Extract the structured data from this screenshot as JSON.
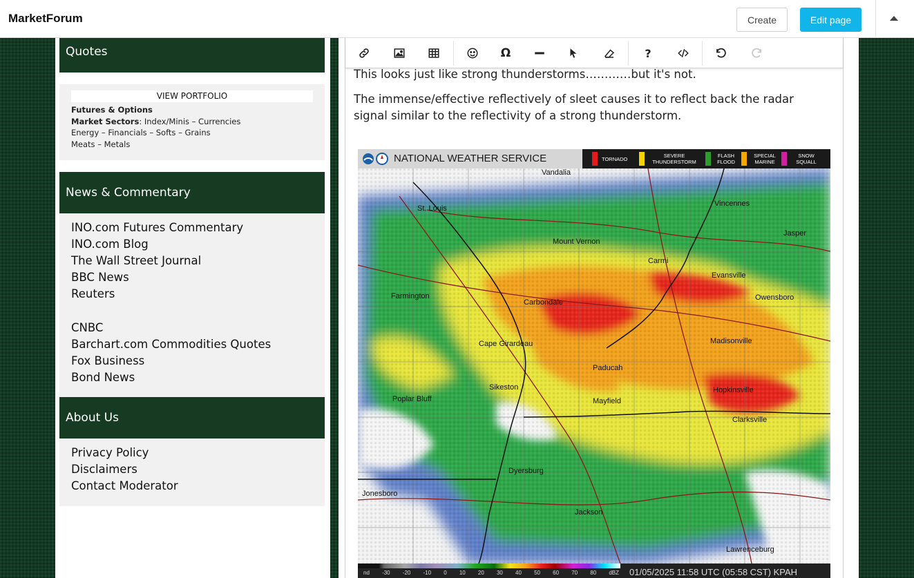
{
  "header": {
    "brand": "MarketForum",
    "create_label": "Create",
    "edit_label": "Edit page"
  },
  "sidebar": {
    "quotes": {
      "title": "Quotes",
      "portfolio_label": "VIEW PORTFOLIO",
      "futures_options": "Futures & Options",
      "market_sectors_label": "Market Sectors",
      "market_sectors_value": ": Index/Minis – Currencies",
      "line3": "Energy – Financials – Softs – Grains",
      "line4": "Meats – Metals"
    },
    "news": {
      "title": "News & Commentary",
      "links_a": [
        "INO.com Futures Commentary",
        "INO.com Blog",
        "The Wall Street Journal",
        "BBC News",
        "Reuters"
      ],
      "links_b": [
        "CNBC",
        "Barchart.com Commodities Quotes",
        "Fox Business",
        "Bond News"
      ]
    },
    "about": {
      "title": "About Us",
      "links": [
        "Privacy Policy",
        "Disclaimers",
        "Contact Moderator"
      ]
    }
  },
  "editor": {
    "toolbar": {
      "icons": [
        "link-icon",
        "image-icon",
        "table-icon",
        "emoji-icon",
        "omega-icon",
        "horizontal-rule-icon",
        "cursor-icon",
        "eraser-icon",
        "help-icon",
        "code-icon",
        "undo-icon",
        "redo-icon"
      ]
    },
    "paragraph1": "This looks just like strong thunderstorms…………but it's not.",
    "paragraph2": "The immense/effective reflectively of sleet causes it to reflect back the radar signal similar to the reflectivity of a strong thunderstorm."
  },
  "radar": {
    "header_title": "NATIONAL WEATHER SERVICE",
    "legend": [
      {
        "label": "TORNADO",
        "color": "#e51b1b"
      },
      {
        "label": "SEVERE THUNDERSTORM",
        "color": "#f5d400"
      },
      {
        "label": "FLASH FLOOD",
        "color": "#2e9b2e"
      },
      {
        "label": "SPECIAL MARINE",
        "color": "#f5a800"
      },
      {
        "label": "SNOW SQUALL",
        "color": "#d21fa0"
      }
    ],
    "places": [
      "Vandalia",
      "St. Louis",
      "Vincennes",
      "Jasper",
      "Mount Vernon",
      "Carmi",
      "Evansville",
      "Owensboro",
      "Farmington",
      "Carbondale",
      "Cape Girardeau",
      "Madisonville",
      "Paducah",
      "Sikeston",
      "Hopkinsville",
      "Poplar Bluff",
      "Mayfield",
      "Clarksville",
      "Dyersburg",
      "Jonesboro",
      "Jackson",
      "Lawrenceburg"
    ],
    "scale_ticks": [
      "nd",
      "-30",
      "-20",
      "-10",
      "0",
      "10",
      "20",
      "30",
      "40",
      "50",
      "60",
      "70",
      "80",
      "dBZ"
    ],
    "timestamp": "01/05/2025 11:58 UTC (05:58 CST) KPAH"
  },
  "colors": {
    "accent": "#12b5ea",
    "section_header": "#173a22",
    "page_bg": "#123a22"
  }
}
